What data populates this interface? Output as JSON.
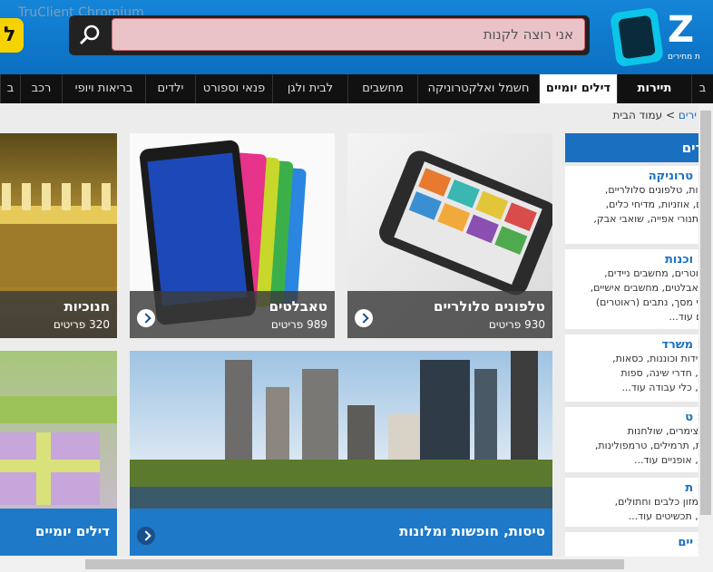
{
  "window": {
    "title": "TruClient Chromium"
  },
  "header": {
    "search_placeholder": "אני רוצה לקנות",
    "logo_text": "Z",
    "logo_tagline": "ת מחירים",
    "left_logo_text": "ל"
  },
  "nav": {
    "items": [
      "תיירות",
      "דילים יומיים",
      "חשמל ואלקטרוניקה",
      "מחשבים",
      "לבית ולגן",
      "פנאי וספורט",
      "ילדים",
      "בריאות ויופי",
      "רכב",
      "ב"
    ],
    "first_fragment": "ב",
    "selected": "דילים יומיים"
  },
  "breadcrumb": {
    "prev": "ירים",
    "sep": ">",
    "current": "עמוד הבית"
  },
  "tiles": [
    {
      "title": "טלפונים סלולריים",
      "count": "930 פריטים"
    },
    {
      "title": "טאבלטים",
      "count": "989 פריטים"
    },
    {
      "title": "חנוכיות",
      "count": "320 פריטים"
    },
    {
      "title": "טיסות, חופשות ומלונות",
      "count": ""
    },
    {
      "title": "דילים יומיים",
      "count": ""
    }
  ],
  "sidebar": {
    "header": "ירים",
    "cards": [
      {
        "title": "« טרוניקה",
        "lines": [
          "מות, טלפונים סלולריים,",
          "ים, אוזניות, מדיחי כלים,",
          ", תנורי אפייה, שואבי אבק,"
        ],
        "more": ""
      },
      {
        "title": "« וכנות",
        "lines": [
          "טוטרים, מחשבים ניידים,",
          "טאבלטים, מחשבים אישיים,",
          "סי מסך, נתבים (ראוטרים)"
        ],
        "more": "ים עוד..."
      },
      {
        "title": "« משרד",
        "lines": [
          "שידות וכוננות, כסאות,",
          "ת, חדרי שינה, ספות",
          "ת, כלי עבודה עוד..."
        ],
        "more": ""
      },
      {
        "title": "« ט",
        "lines": [
          ", צימרים, שולחנות",
          "ות, תרמילים, טרמפולינות,",
          "ם, אופניים עוד..."
        ],
        "more": ""
      },
      {
        "title": "« ת",
        "lines": [
          ", מזון כלבים וחתולים,",
          "ם, תכשיטים עוד..."
        ],
        "more": ""
      },
      {
        "title": "« יים",
        "lines": [],
        "more": ""
      }
    ]
  },
  "colors": {
    "header_blue": "#1585d8",
    "accent_blue": "#1a6fc1",
    "search_bg": "#eac3c8",
    "nav_bg": "#111111"
  }
}
